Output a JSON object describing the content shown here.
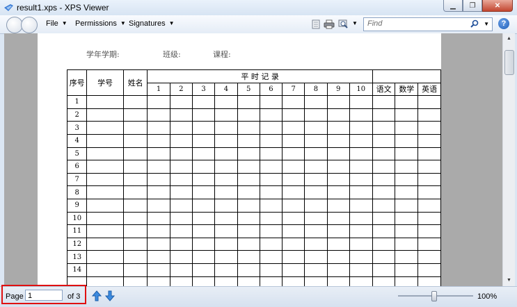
{
  "window": {
    "title": "result1.xps - XPS Viewer"
  },
  "toolbar": {
    "menus": [
      {
        "label": "File"
      },
      {
        "label": "Permissions"
      },
      {
        "label": "Signatures"
      }
    ],
    "find_placeholder": "Find",
    "help_label": "?"
  },
  "document": {
    "header_fields": [
      "学年学期:",
      "班级:",
      "课程:"
    ],
    "col_xuhao": "序号",
    "col_xuehao": "学号",
    "col_xingming": "姓名",
    "group_header": "平 时 记 录",
    "record_cols": [
      "1",
      "2",
      "3",
      "4",
      "5",
      "6",
      "7",
      "8",
      "9",
      "10"
    ],
    "subject_cols": [
      "语文",
      "数学",
      "英语"
    ],
    "row_numbers": [
      "1",
      "2",
      "3",
      "4",
      "5",
      "6",
      "7",
      "8",
      "9",
      "10",
      "11",
      "12",
      "13",
      "14"
    ]
  },
  "status": {
    "page_label": "Page",
    "page_value": "1",
    "page_of": "of 3",
    "zoom": "100%"
  }
}
